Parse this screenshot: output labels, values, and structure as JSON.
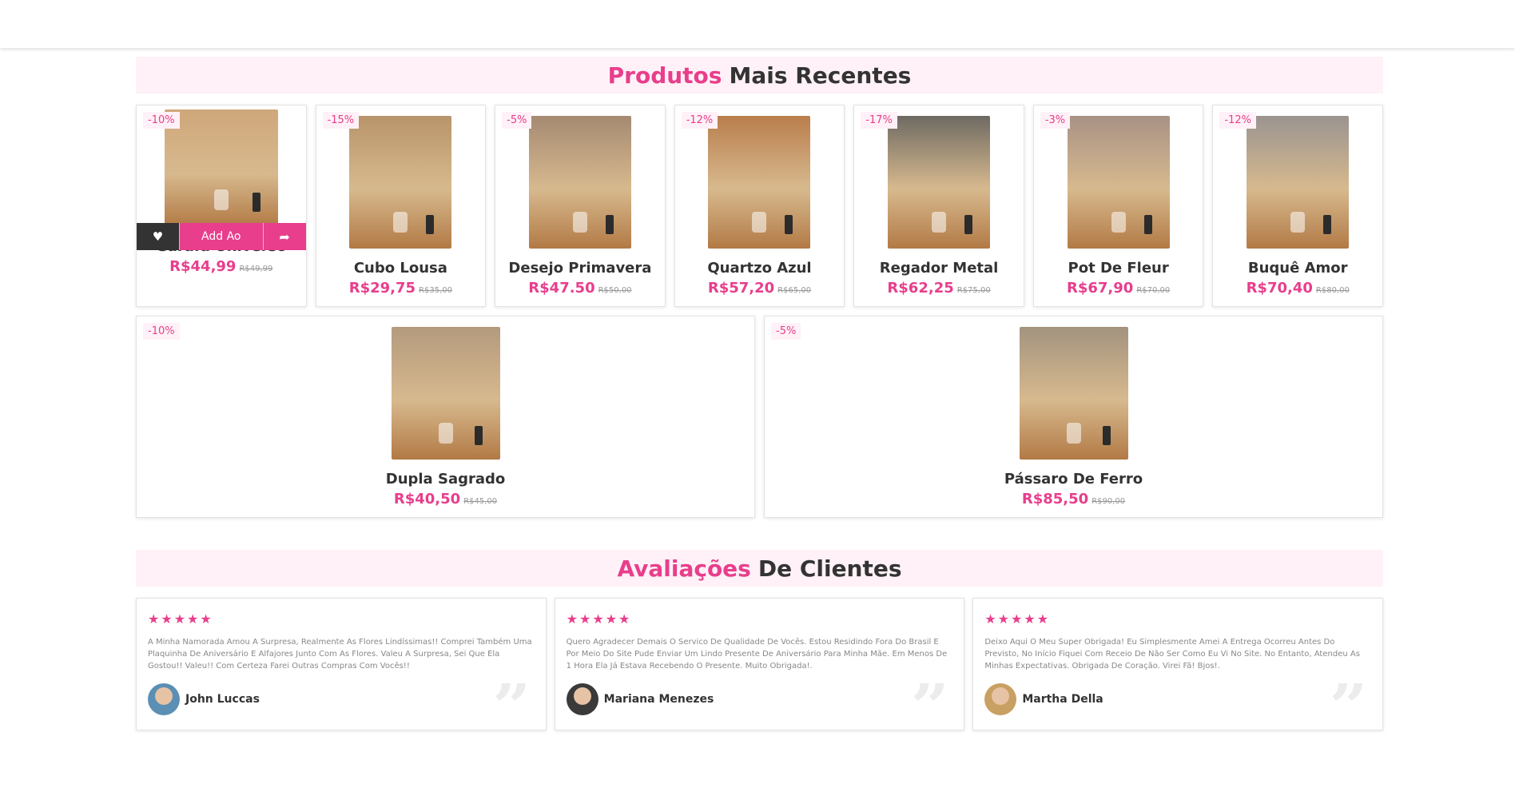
{
  "recent": {
    "title_accent": "Produtos",
    "title_rest": "Mais Recentes",
    "action_bar": {
      "add_label": "Add Ao"
    },
    "products_row1": [
      {
        "badge": "-10%",
        "name": "Garafa Universo",
        "price": "R$44,99",
        "old_price": "R$49,99",
        "bg": "#cfa77a"
      },
      {
        "badge": "-15%",
        "name": "Cubo Lousa",
        "price": "R$29,75",
        "old_price": "R$35,00",
        "bg": "#b8946a"
      },
      {
        "badge": "-5%",
        "name": "Desejo Primavera",
        "price": "R$47.50",
        "old_price": "R$50,00",
        "bg": "#a58a72"
      },
      {
        "badge": "-12%",
        "name": "Quartzo Azul",
        "price": "R$57,20",
        "old_price": "R$65,00",
        "bg": "#b97e4c"
      },
      {
        "badge": "-17%",
        "name": "Regador Metal",
        "price": "R$62,25",
        "old_price": "R$75,00",
        "bg": "#6e6a62"
      },
      {
        "badge": "-3%",
        "name": "Pot De Fleur",
        "price": "R$67,90",
        "old_price": "R$70,00",
        "bg": "#a89285"
      },
      {
        "badge": "-12%",
        "name": "Buquê Amor",
        "price": "R$70,40",
        "old_price": "R$80,00",
        "bg": "#9a9490"
      }
    ],
    "products_row2": [
      {
        "badge": "-10%",
        "name": "Dupla Sagrado",
        "price": "R$40,50",
        "old_price": "R$45,00",
        "bg": "#b49a7e"
      },
      {
        "badge": "-5%",
        "name": "Pássaro De Ferro",
        "price": "R$85,50",
        "old_price": "R$90,00",
        "bg": "#a3937f"
      }
    ]
  },
  "reviews": {
    "title_accent": "Avaliações",
    "title_rest": "De Clientes",
    "stars": "★★★★★",
    "quote_mark": "”",
    "items": [
      {
        "text": "A Minha Namorada Amou A Surpresa, Realmente As Flores Lindíssimas!! Comprei Também Uma Plaquinha De Aniversário E Alfajores Junto Com As Flores. Valeu A Surpresa, Sei Que Ela Gostou!! Valeu!! Com Certeza Farei Outras Compras Com Vocês!!",
        "author": "John Luccas",
        "avatar_color": "#5b8fb3"
      },
      {
        "text": "Quero Agradecer Demais O Servico De Qualidade De Vocês. Estou Residindo Fora Do Brasil E Por Meio Do Site Pude Enviar Um Lindo Presente De Aniversário Para Minha Mãe. Em Menos De 1 Hora Ela Já Estava Recebendo O Presente. Muito Obrigada!.",
        "author": "Mariana Menezes",
        "avatar_color": "#3a3a3a"
      },
      {
        "text": "Deixo Aqui O Meu Super Obrigada! Eu Simplesmente Amei A Entrega Ocorreu Antes Do Previsto, No Início Fiquei Com Receio De Não Ser Como Eu Vi No Site. No Entanto, Atendeu As Minhas Expectativas. Obrigada De Coração. Virei Fã! Bjos!.",
        "author": "Martha Della",
        "avatar_color": "#c9a063"
      }
    ]
  },
  "colors": {
    "accent": "#e83e8c",
    "heading_bg": "#fff1f7",
    "dark": "#333333"
  }
}
